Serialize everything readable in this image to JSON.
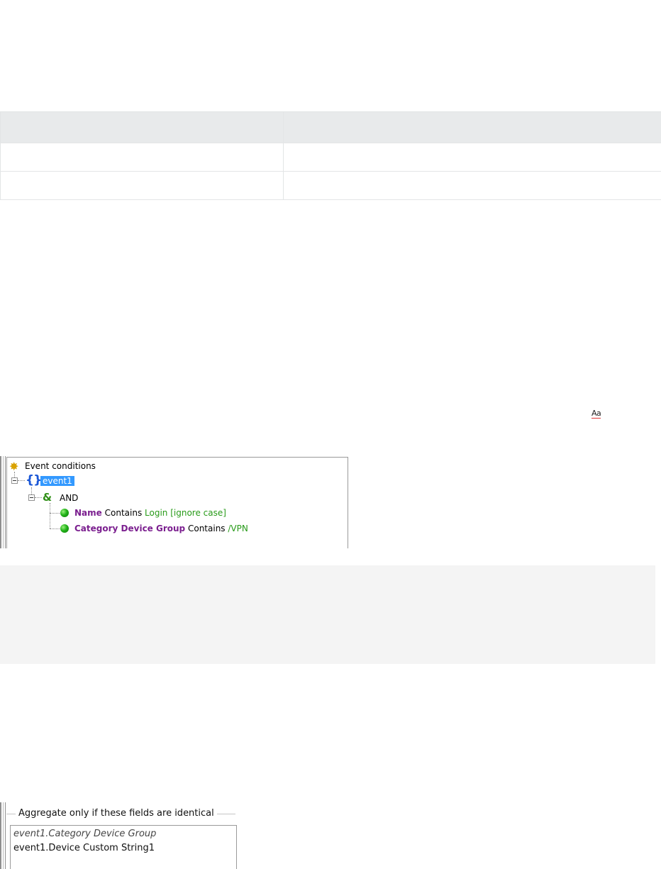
{
  "table": {
    "headers": [
      "",
      ""
    ],
    "rows": [
      [
        "",
        ""
      ],
      [
        "",
        ""
      ]
    ]
  },
  "aa_glyph": {
    "text": "Aa"
  },
  "tree": {
    "root_label": "Event conditions",
    "event_label": "event1",
    "operator_label": "AND",
    "conditions": [
      {
        "field": "Name",
        "operator": "Contains",
        "value": "Login [ignore case]"
      },
      {
        "field": "Category Device Group",
        "operator": "Contains",
        "value": "/VPN"
      }
    ],
    "colors": {
      "selection": "#3399ff",
      "field": "#7b1f8f",
      "value": "#279a18",
      "braces": "#1b57d6"
    }
  },
  "aggregate": {
    "title": "Aggregate only if these fields are identical",
    "items": [
      "event1.Category Device Group",
      "event1.Device Custom String1"
    ]
  }
}
